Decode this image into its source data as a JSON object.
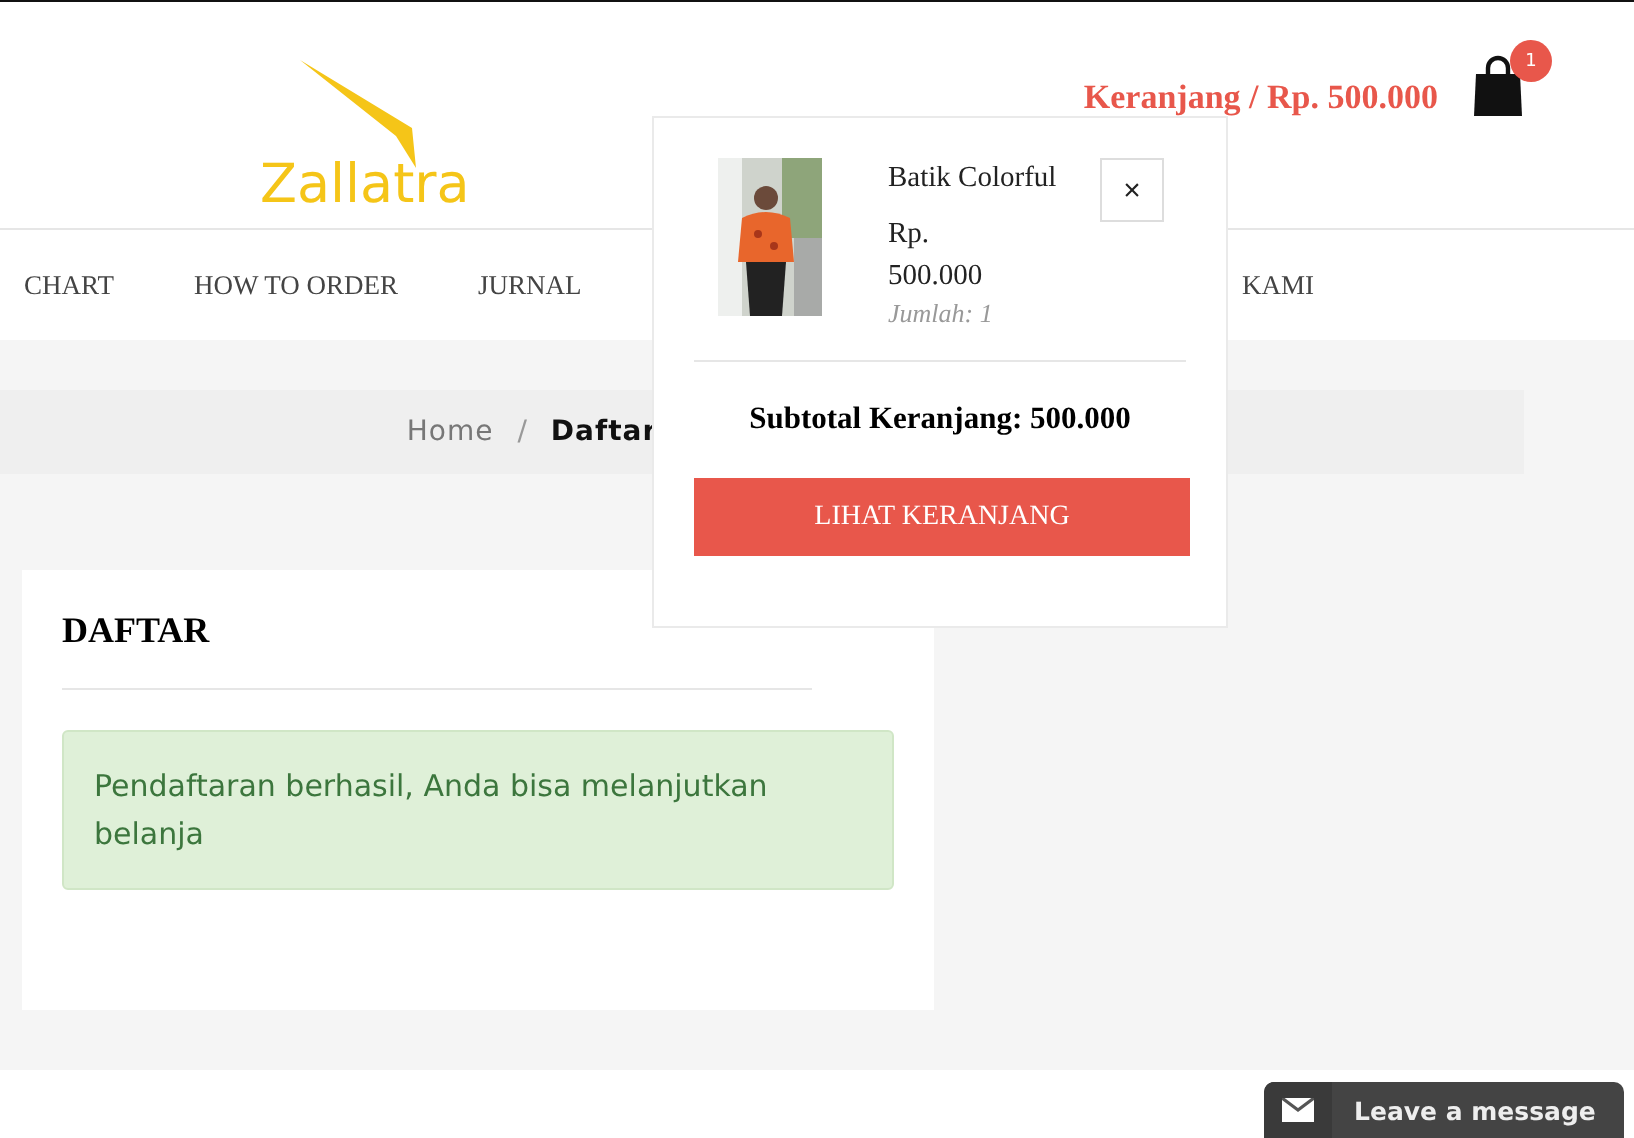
{
  "header": {
    "logo": "Zallatra",
    "cart_link": "Keranjang / Rp. 500.000",
    "cart_count": "1"
  },
  "nav": {
    "items": [
      "CHART",
      "HOW TO ORDER",
      "JURNAL",
      "KAMI"
    ]
  },
  "breadcrumb": {
    "items": [
      {
        "label": "Home",
        "selected": false
      },
      {
        "label": "Daftar",
        "selected": true
      }
    ],
    "separator": "/"
  },
  "card": {
    "title": "DAFTAR",
    "alert": "Pendaftaran berhasil, Anda bisa melanjutkan belanja"
  },
  "cart_dropdown": {
    "items": [
      {
        "name": "Batik Colorful",
        "price_label": "Rp.",
        "price": "500.000",
        "quantity": "Jumlah: 1",
        "remove": "×"
      }
    ],
    "subtotal": "Subtotal Keranjang: 500.000",
    "button": "LIHAT KERANJANG"
  },
  "chat": {
    "label": "Leave a message"
  }
}
